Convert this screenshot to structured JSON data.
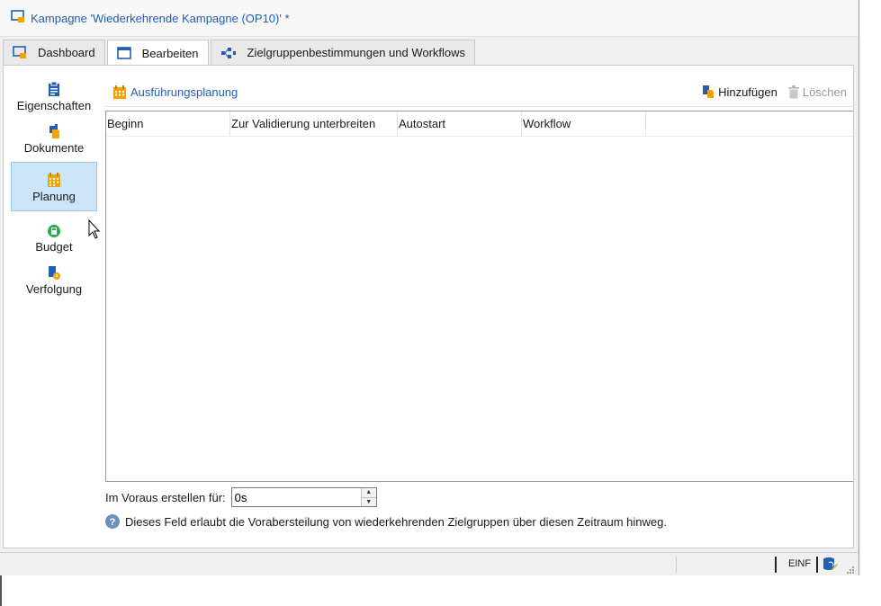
{
  "window": {
    "title": "Kampagne 'Wiederkehrende Kampagne (OP10)' *"
  },
  "tabs": [
    {
      "label": "Dashboard",
      "icon": "dashboard-icon"
    },
    {
      "label": "Bearbeiten",
      "icon": "edit-window-icon",
      "active": true
    },
    {
      "label": "Zielgruppenbestimmungen und Workflows",
      "icon": "workflow-icon"
    }
  ],
  "sidebar": {
    "items": [
      {
        "label": "Eigenschaften",
        "icon": "clipboard-icon"
      },
      {
        "label": "Dokumente",
        "icon": "documents-icon"
      },
      {
        "label": "Planung",
        "icon": "calendar-icon",
        "active": true
      },
      {
        "label": "Budget",
        "icon": "budget-icon"
      },
      {
        "label": "Verfolgung",
        "icon": "tracking-icon"
      }
    ]
  },
  "toolbar": {
    "section_title": "Ausführungsplanung",
    "add_label": "Hinzufügen",
    "delete_label": "Löschen"
  },
  "grid": {
    "columns": [
      "Beginn",
      "Zur Validierung unterbreiten",
      "Autostart",
      "Workflow"
    ],
    "rows": []
  },
  "advance": {
    "label": "Im Voraus erstellen für:",
    "value": "0s"
  },
  "help": {
    "text": "Dieses Feld erlaubt die Vorabersteilung von wiederkehrenden Zielgruppen über diesen Zeitraum hinweg."
  },
  "statusbar": {
    "insert_mode": "EINF"
  },
  "colors": {
    "accent": "#1f5fb4",
    "selected_bg": "#cce4f7",
    "orange": "#f0a30a"
  }
}
